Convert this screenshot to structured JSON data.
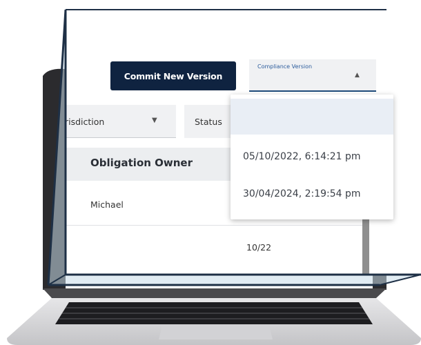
{
  "toolbar": {
    "commit_label": "Commit New Version"
  },
  "compliance_version": {
    "label": "Compliance Version",
    "options": [
      "",
      "05/10/2022, 6:14:21 pm",
      "30/04/2024, 2:19:54 pm"
    ]
  },
  "filters": {
    "jurisdiction": "risdiction",
    "status": "Status"
  },
  "table": {
    "columns": [
      "Obligation Owner"
    ],
    "rows": [
      {
        "obligation_owner": "Michael"
      },
      {
        "date_fragment": "10/22"
      }
    ]
  },
  "colors": {
    "primary": "#0f2340",
    "accent": "#1e4a7a",
    "frame": "#c8dcea"
  }
}
